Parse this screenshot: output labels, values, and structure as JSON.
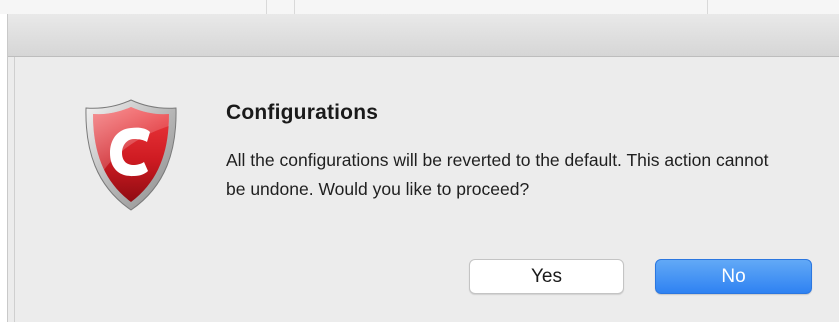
{
  "dialog": {
    "title": "Configurations",
    "message": "All the configurations will be reverted to the default. This action cannot be undone. Would you like to proceed?",
    "icon": "comodo-shield-icon",
    "buttons": {
      "yes_label": "Yes",
      "no_label": "No"
    }
  },
  "colors": {
    "default_button": "#3a8bf3",
    "shield_red": "#d21f26"
  }
}
